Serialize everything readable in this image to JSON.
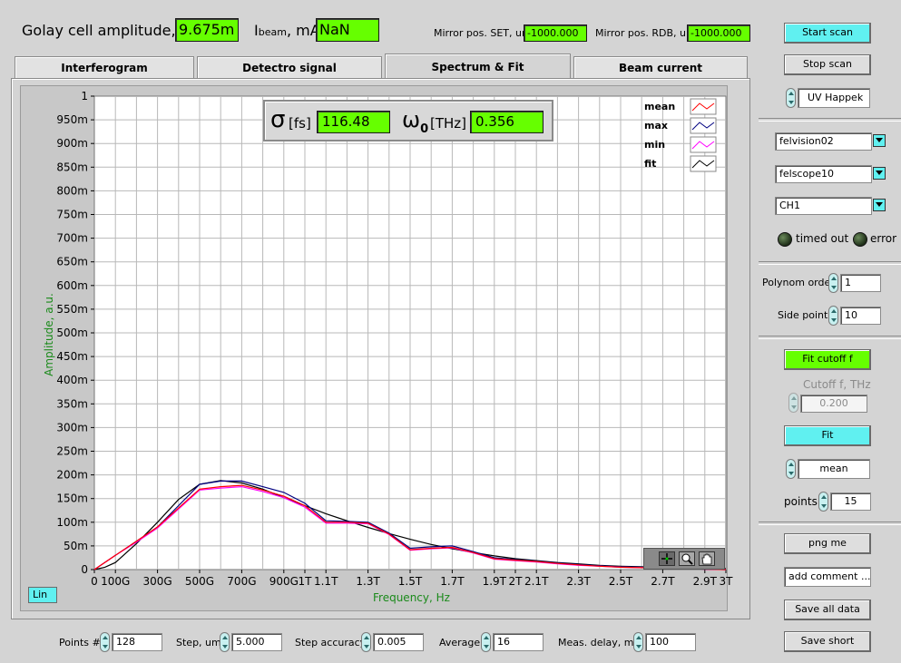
{
  "header": {
    "golay_label": "Golay cell amplitude, V",
    "golay_value": "9.675m",
    "ibeam_label_main": "I",
    "ibeam_label_sub": "beam",
    "ibeam_label_unit": ", mA",
    "ibeam_value": "NaN",
    "mirror_set_label": "Mirror pos. SET, um",
    "mirror_set_value": "-1000.000",
    "mirror_rdb_label": "Mirror pos. RDB, um",
    "mirror_rdb_value": "-1000.000"
  },
  "tabs": [
    {
      "label": "Interferogram",
      "active": false
    },
    {
      "label": "Detectro signal",
      "active": false
    },
    {
      "label": "Spectrum & Fit",
      "active": true
    },
    {
      "label": "Beam current",
      "active": false
    }
  ],
  "fit_display": {
    "sigma_symbol": "σ",
    "sigma_unit": "[fs]",
    "sigma_value": "116.48",
    "omega_symbol": "ω",
    "omega_sub": "0",
    "omega_unit": "[THz]",
    "omega_value": "0.356"
  },
  "scale_button": "Lin",
  "chart_data": {
    "type": "line",
    "xlabel": "Frequency, Hz",
    "ylabel": "Amplitude, a.u.",
    "xlim": [
      0,
      3.0
    ],
    "ylim": [
      0,
      1
    ],
    "grid": true,
    "legend_position": "top-right",
    "y_ticks": [
      "0",
      "50m",
      "100m",
      "150m",
      "200m",
      "250m",
      "300m",
      "350m",
      "400m",
      "450m",
      "500m",
      "550m",
      "600m",
      "650m",
      "700m",
      "750m",
      "800m",
      "850m",
      "900m",
      "950m",
      "1"
    ],
    "x_ticks": [
      {
        "v": 0,
        "label": "0"
      },
      {
        "v": 0.1,
        "label": "100G"
      },
      {
        "v": 0.3,
        "label": "300G"
      },
      {
        "v": 0.5,
        "label": "500G"
      },
      {
        "v": 0.7,
        "label": "700G"
      },
      {
        "v": 0.9,
        "label": "900G"
      },
      {
        "v": 1.0,
        "label": "1T"
      },
      {
        "v": 1.1,
        "label": "1.1T"
      },
      {
        "v": 1.3,
        "label": "1.3T"
      },
      {
        "v": 1.5,
        "label": "1.5T"
      },
      {
        "v": 1.7,
        "label": "1.7T"
      },
      {
        "v": 1.9,
        "label": "1.9T"
      },
      {
        "v": 2.0,
        "label": "2T"
      },
      {
        "v": 2.1,
        "label": "2.1T"
      },
      {
        "v": 2.3,
        "label": "2.3T"
      },
      {
        "v": 2.5,
        "label": "2.5T"
      },
      {
        "v": 2.7,
        "label": "2.7T"
      },
      {
        "v": 2.9,
        "label": "2.9T"
      },
      {
        "v": 3.0,
        "label": "3T"
      }
    ],
    "series": [
      {
        "name": "mean",
        "color": "#ff0000",
        "x": [
          0,
          0.1,
          0.2,
          0.3,
          0.4,
          0.5,
          0.6,
          0.7,
          0.8,
          0.9,
          1.0,
          1.1,
          1.2,
          1.3,
          1.4,
          1.5,
          1.6,
          1.7,
          1.8,
          1.9,
          2.0,
          2.1,
          2.2,
          2.3,
          2.4,
          2.5,
          2.6,
          2.7,
          2.8,
          2.9,
          3.0
        ],
        "y": [
          0,
          0.03,
          0.06,
          0.09,
          0.13,
          0.17,
          0.175,
          0.178,
          0.168,
          0.155,
          0.135,
          0.1,
          0.1,
          0.098,
          0.075,
          0.042,
          0.045,
          0.047,
          0.036,
          0.023,
          0.02,
          0.017,
          0.013,
          0.01,
          0.007,
          0.005,
          0.004,
          0.003,
          0.002,
          0.001,
          0
        ]
      },
      {
        "name": "max",
        "color": "#000080",
        "x": [
          0,
          0.1,
          0.2,
          0.3,
          0.4,
          0.5,
          0.6,
          0.7,
          0.8,
          0.9,
          1.0,
          1.1,
          1.2,
          1.3,
          1.4,
          1.5,
          1.6,
          1.7,
          1.8,
          1.9,
          2.0,
          2.1,
          2.2,
          2.3,
          2.4,
          2.5,
          2.6,
          2.7,
          2.8,
          2.9,
          3.0
        ],
        "y": [
          0,
          0.03,
          0.06,
          0.09,
          0.135,
          0.18,
          0.187,
          0.187,
          0.175,
          0.163,
          0.14,
          0.103,
          0.102,
          0.1,
          0.077,
          0.045,
          0.048,
          0.05,
          0.038,
          0.025,
          0.021,
          0.018,
          0.014,
          0.011,
          0.008,
          0.006,
          0.005,
          0.003,
          0.002,
          0.001,
          0
        ]
      },
      {
        "name": "min",
        "color": "#ff00ff",
        "x": [
          0,
          0.1,
          0.2,
          0.3,
          0.4,
          0.5,
          0.6,
          0.7,
          0.8,
          0.9,
          1.0,
          1.1,
          1.2,
          1.3,
          1.4,
          1.5,
          1.6,
          1.7,
          1.8,
          1.9,
          2.0,
          2.1,
          2.2,
          2.3,
          2.4,
          2.5,
          2.6,
          2.7,
          2.8,
          2.9,
          3.0
        ],
        "y": [
          0,
          0.03,
          0.058,
          0.088,
          0.128,
          0.168,
          0.172,
          0.175,
          0.165,
          0.152,
          0.132,
          0.098,
          0.098,
          0.097,
          0.074,
          0.041,
          0.044,
          0.046,
          0.035,
          0.022,
          0.019,
          0.016,
          0.012,
          0.009,
          0.007,
          0.005,
          0.004,
          0.003,
          0.002,
          0.001,
          0
        ]
      },
      {
        "name": "fit",
        "color": "#000000",
        "x": [
          0,
          0.05,
          0.1,
          0.2,
          0.3,
          0.4,
          0.5,
          0.6,
          0.7,
          0.8,
          0.9,
          1.0,
          1.1,
          1.2,
          1.3,
          1.4,
          1.5,
          1.6,
          1.7,
          1.8,
          1.9,
          2.0,
          2.1,
          2.2,
          2.3,
          2.4,
          2.5,
          2.6,
          2.7,
          2.8,
          2.9,
          3.0
        ],
        "y": [
          0,
          0.005,
          0.015,
          0.055,
          0.1,
          0.148,
          0.18,
          0.188,
          0.183,
          0.17,
          0.152,
          0.135,
          0.118,
          0.103,
          0.089,
          0.076,
          0.064,
          0.053,
          0.044,
          0.036,
          0.029,
          0.023,
          0.019,
          0.015,
          0.012,
          0.009,
          0.007,
          0.006,
          0.004,
          0.003,
          0.002,
          0.002
        ]
      }
    ]
  },
  "right_panel": {
    "start_scan": "Start scan",
    "stop_scan": "Stop scan",
    "source_select": "UV Happek",
    "device1": "felvision02",
    "device2": "felscope10",
    "channel": "CH1",
    "timed_out_label": "timed out",
    "error_label": "error",
    "polynom_label": "Polynom order",
    "polynom_value": "1",
    "side_points_label": "Side points",
    "side_points_value": "10",
    "fit_cutoff_button": "Fit cutoff f",
    "cutoff_label": "Cutoff f, THz",
    "cutoff_value": "0.200",
    "fit_button": "Fit",
    "fit_mode": "mean",
    "points_label": "points",
    "points_value": "15",
    "png_button": "png me",
    "comment_placeholder": "add comment ...",
    "save_all_button": "Save all data",
    "save_short_button": "Save short"
  },
  "bottom": {
    "points_label": "Points #",
    "points_value": "128",
    "step_label": "Step, um",
    "step_value": "5.000",
    "accuracy_label": "Step accuracy",
    "accuracy_value": "0.005",
    "average_label": "Average",
    "average_value": "16",
    "delay_label": "Meas. delay, ms",
    "delay_value": "100"
  }
}
